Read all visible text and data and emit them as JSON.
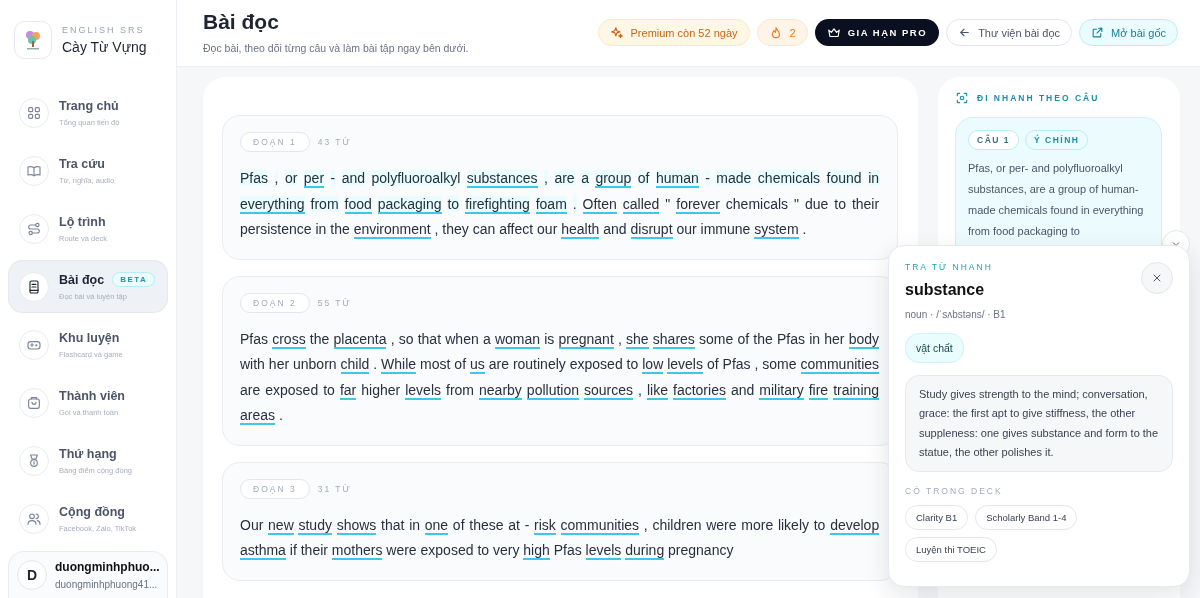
{
  "brand": {
    "kicker": "ENGLISH SRS",
    "name": "Cày Từ Vựng"
  },
  "nav": [
    {
      "label": "Trang chủ",
      "hint": "Tổng quan tiến độ",
      "selected": false
    },
    {
      "label": "Tra cứu",
      "hint": "Từ, nghĩa, audio",
      "selected": false
    },
    {
      "label": "Lộ trình",
      "hint": "Route và deck",
      "selected": false
    },
    {
      "label": "Bài đọc",
      "hint": "Đọc bài và luyện tập",
      "selected": true,
      "badge": "BETA"
    },
    {
      "label": "Khu luyện",
      "hint": "Flashcard và game",
      "selected": false
    },
    {
      "label": "Thành viên",
      "hint": "Gói và thanh toán",
      "selected": false
    },
    {
      "label": "Thứ hạng",
      "hint": "Bảng điểm cộng đồng",
      "selected": false
    },
    {
      "label": "Cộng đồng",
      "hint": "Facebook, Zalo, TikTok",
      "selected": false
    }
  ],
  "user": {
    "initial": "D",
    "name": "duongminhphuo...",
    "email": "duongminhphuong41..."
  },
  "header": {
    "title": "Bài đọc",
    "subtitle": "Đọc bài, theo dõi từng câu và làm bài tập ngay bên dưới.",
    "actions": [
      {
        "kind": "premium",
        "label": "Premium còn 52 ngày"
      },
      {
        "kind": "streak",
        "label": "2"
      },
      {
        "kind": "pro",
        "label": "GIA HẠN PRO"
      },
      {
        "kind": "back",
        "label": "Thư viện bài đọc"
      },
      {
        "kind": "open",
        "label": "Mở bài gốc"
      }
    ]
  },
  "paragraphs": [
    {
      "label": "ĐOẠN 1",
      "count": "43 TỪ",
      "sentences": [
        {
          "selected": true,
          "words": [
            {
              "text": "Pfas",
              "linked": false
            },
            {
              "text": ",",
              "linked": false
            },
            {
              "text": "or",
              "linked": false
            },
            {
              "text": "per",
              "linked": true
            },
            {
              "text": "-",
              "linked": false
            },
            {
              "text": "and",
              "linked": false
            },
            {
              "text": "polyfluoroalkyl",
              "linked": false
            },
            {
              "text": "substances",
              "linked": true
            },
            {
              "text": ",",
              "linked": false
            },
            {
              "text": "are",
              "linked": false
            },
            {
              "text": "a",
              "linked": false
            },
            {
              "text": "group",
              "linked": true
            },
            {
              "text": "of",
              "linked": false
            },
            {
              "text": "human",
              "linked": true
            },
            {
              "text": "-",
              "linked": false
            },
            {
              "text": "made",
              "linked": false
            },
            {
              "text": "chemicals",
              "linked": false
            },
            {
              "text": "found",
              "linked": false
            },
            {
              "text": "in",
              "linked": false
            },
            {
              "text": "everything",
              "linked": true
            },
            {
              "text": "from",
              "linked": false
            },
            {
              "text": "food",
              "linked": true
            },
            {
              "text": "packaging",
              "linked": true
            },
            {
              "text": "to",
              "linked": false
            },
            {
              "text": "firefighting",
              "linked": true
            },
            {
              "text": "foam",
              "linked": true
            },
            {
              "text": ".",
              "linked": false
            }
          ]
        },
        {
          "selected": false,
          "words": [
            {
              "text": "Often",
              "linked": true
            },
            {
              "text": "called",
              "linked": true
            },
            {
              "text": "\"",
              "linked": false
            },
            {
              "text": "forever",
              "linked": true
            },
            {
              "text": "chemicals",
              "linked": false
            },
            {
              "text": "\"",
              "linked": false
            },
            {
              "text": "due",
              "linked": false
            },
            {
              "text": "to",
              "linked": false
            },
            {
              "text": "their",
              "linked": false
            },
            {
              "text": "persistence",
              "linked": false
            },
            {
              "text": "in",
              "linked": false
            },
            {
              "text": "the",
              "linked": false
            },
            {
              "text": "environment",
              "linked": true
            },
            {
              "text": ",",
              "linked": false
            },
            {
              "text": "they",
              "linked": false
            },
            {
              "text": "can",
              "linked": false
            },
            {
              "text": "affect",
              "linked": false
            },
            {
              "text": "our",
              "linked": false
            },
            {
              "text": "health",
              "linked": true
            },
            {
              "text": "and",
              "linked": false
            },
            {
              "text": "disrupt",
              "linked": true
            },
            {
              "text": "our",
              "linked": false
            },
            {
              "text": "immune",
              "linked": false
            },
            {
              "text": "system",
              "linked": true
            },
            {
              "text": ".",
              "linked": false
            }
          ]
        }
      ]
    },
    {
      "label": "ĐOẠN 2",
      "count": "55 TỪ",
      "sentences": [
        {
          "selected": false,
          "words": [
            {
              "text": "Pfas",
              "linked": false
            },
            {
              "text": "cross",
              "linked": true
            },
            {
              "text": "the",
              "linked": false
            },
            {
              "text": "placenta",
              "linked": true
            },
            {
              "text": ",",
              "linked": false
            },
            {
              "text": "so",
              "linked": false
            },
            {
              "text": "that",
              "linked": false
            },
            {
              "text": "when",
              "linked": false
            },
            {
              "text": "a",
              "linked": false
            },
            {
              "text": "woman",
              "linked": true
            },
            {
              "text": "is",
              "linked": false
            },
            {
              "text": "pregnant",
              "linked": true
            },
            {
              "text": ",",
              "linked": false
            },
            {
              "text": "she",
              "linked": true
            },
            {
              "text": "shares",
              "linked": true
            },
            {
              "text": "some",
              "linked": false
            },
            {
              "text": "of",
              "linked": false
            },
            {
              "text": "the",
              "linked": false
            },
            {
              "text": "Pfas",
              "linked": false
            },
            {
              "text": "in",
              "linked": false
            },
            {
              "text": "her",
              "linked": false
            },
            {
              "text": "body",
              "linked": true
            },
            {
              "text": "with",
              "linked": false
            },
            {
              "text": "her",
              "linked": false
            },
            {
              "text": "unborn",
              "linked": false
            },
            {
              "text": "child",
              "linked": true
            },
            {
              "text": ".",
              "linked": false
            }
          ]
        },
        {
          "selected": false,
          "words": [
            {
              "text": "While",
              "linked": true
            },
            {
              "text": "most",
              "linked": false
            },
            {
              "text": "of",
              "linked": false
            },
            {
              "text": "us",
              "linked": true
            },
            {
              "text": "are",
              "linked": false
            },
            {
              "text": "routinely",
              "linked": false
            },
            {
              "text": "exposed",
              "linked": false
            },
            {
              "text": "to",
              "linked": false
            },
            {
              "text": "low",
              "linked": true
            },
            {
              "text": "levels",
              "linked": true
            },
            {
              "text": "of",
              "linked": false
            },
            {
              "text": "Pfas",
              "linked": false
            },
            {
              "text": ",",
              "linked": false
            },
            {
              "text": "some",
              "linked": false
            },
            {
              "text": "communities",
              "linked": true
            },
            {
              "text": "are",
              "linked": false
            },
            {
              "text": "exposed",
              "linked": false
            },
            {
              "text": "to",
              "linked": false
            },
            {
              "text": "far",
              "linked": true
            },
            {
              "text": "higher",
              "linked": false
            },
            {
              "text": "levels",
              "linked": true
            },
            {
              "text": "from",
              "linked": false
            },
            {
              "text": "nearby",
              "linked": true
            },
            {
              "text": "pollution",
              "linked": true
            },
            {
              "text": "sources",
              "linked": true
            },
            {
              "text": ",",
              "linked": false
            },
            {
              "text": "like",
              "linked": true
            },
            {
              "text": "factories",
              "linked": true
            },
            {
              "text": "and",
              "linked": false
            },
            {
              "text": "military",
              "linked": true
            },
            {
              "text": "fire",
              "linked": true
            },
            {
              "text": "training",
              "linked": true
            },
            {
              "text": "areas",
              "linked": true
            },
            {
              "text": ".",
              "linked": false
            }
          ]
        }
      ]
    },
    {
      "label": "ĐOẠN 3",
      "count": "31 TỪ",
      "sentences": [
        {
          "selected": false,
          "words": [
            {
              "text": "Our",
              "linked": false
            },
            {
              "text": "new",
              "linked": true
            },
            {
              "text": "study",
              "linked": true
            },
            {
              "text": "shows",
              "linked": true
            },
            {
              "text": "that",
              "linked": false
            },
            {
              "text": "in",
              "linked": false
            },
            {
              "text": "one",
              "linked": true
            },
            {
              "text": "of",
              "linked": false
            },
            {
              "text": "these",
              "linked": false
            },
            {
              "text": "at",
              "linked": false
            },
            {
              "text": "-",
              "linked": false
            },
            {
              "text": "risk",
              "linked": true
            },
            {
              "text": "communities",
              "linked": true
            },
            {
              "text": ",",
              "linked": false
            },
            {
              "text": "children",
              "linked": false
            },
            {
              "text": "were",
              "linked": false
            },
            {
              "text": "more",
              "linked": false
            },
            {
              "text": "likely",
              "linked": false
            },
            {
              "text": "to",
              "linked": false
            },
            {
              "text": "develop",
              "linked": true
            },
            {
              "text": "asthma",
              "linked": true
            },
            {
              "text": "if",
              "linked": false
            },
            {
              "text": "their",
              "linked": false
            },
            {
              "text": "mothers",
              "linked": true
            },
            {
              "text": "were",
              "linked": false
            },
            {
              "text": "exposed",
              "linked": false
            },
            {
              "text": "to",
              "linked": false
            },
            {
              "text": "very",
              "linked": false
            },
            {
              "text": "high",
              "linked": true
            },
            {
              "text": "Pfas",
              "linked": false
            },
            {
              "text": "levels",
              "linked": true
            },
            {
              "text": "during",
              "linked": true
            },
            {
              "text": "pregnancy",
              "linked": false
            }
          ]
        }
      ]
    }
  ],
  "quick_nav": {
    "heading": "ĐI NHANH THEO CÂU",
    "tags": [
      "CÂU 1",
      "Ý CHÍNH"
    ],
    "text": "Pfas, or per- and polyfluoroalkyl substances, are a group of human-made chemicals found in everything from food packaging to"
  },
  "lookup": {
    "kicker": "TRA TỪ NHANH",
    "word": "substance",
    "meta": "noun · /ˈsʌbstəns/ · B1",
    "meaning": "vật chất",
    "example": "Study gives strength to the mind; conversation, grace: the first apt to give stiffness, the other suppleness: one gives substance and form to the statue, the other polishes it.",
    "deck_heading": "CÓ TRONG DECK",
    "decks": [
      "Clarity B1",
      "Scholarly Band 1-4",
      "Luyện thi TOEIC"
    ]
  }
}
